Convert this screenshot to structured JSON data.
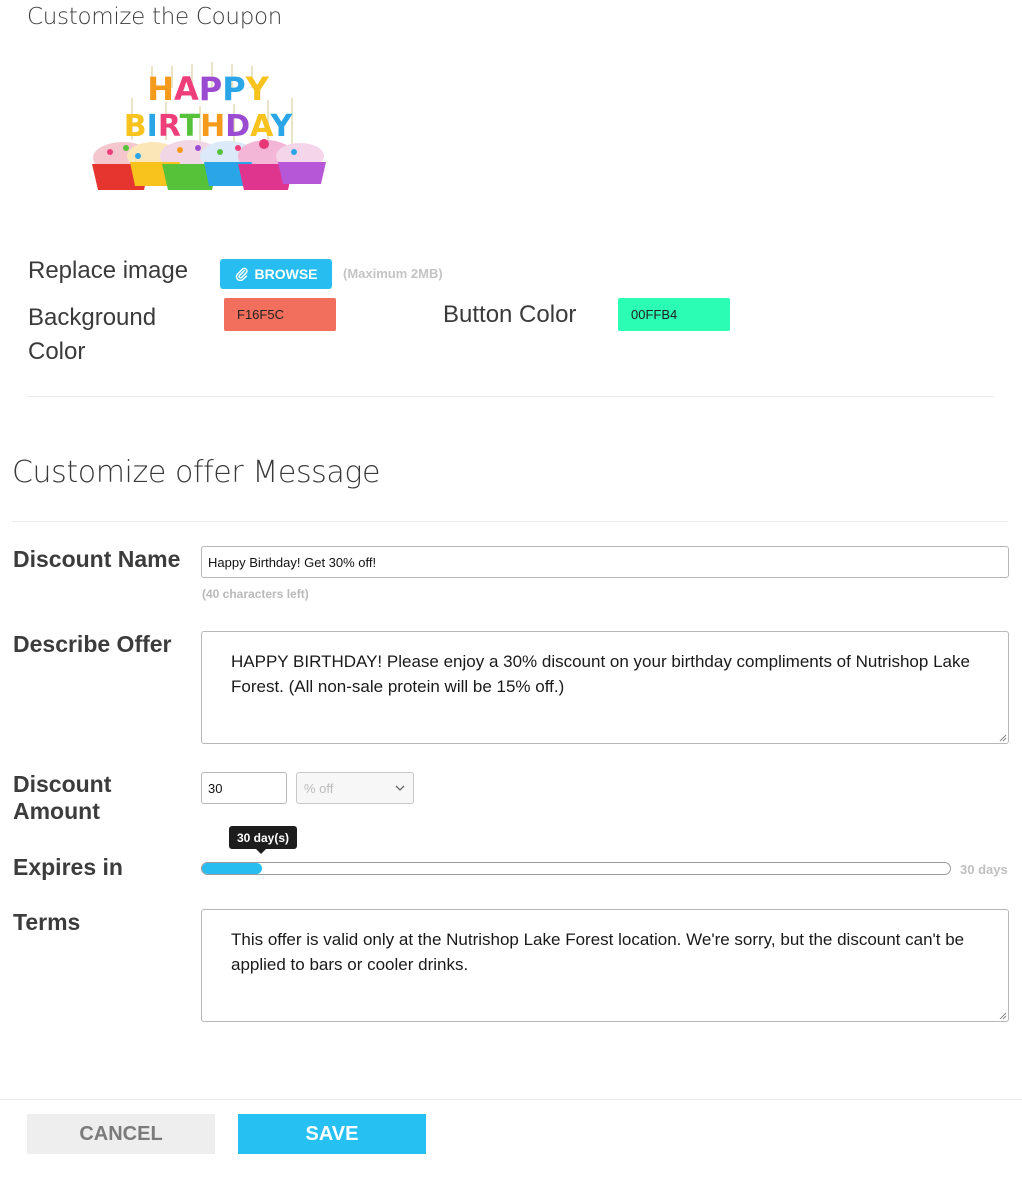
{
  "coupon": {
    "title": "Customize the Coupon",
    "image_text": "HAPPY BIRTHDAY",
    "replace_label": "Replace image",
    "browse_label": "BROWSE",
    "browse_note": "(Maximum 2MB)",
    "bg_color_label_line1": "Background",
    "bg_color_label_line2": "Color",
    "bg_color_value": "F16F5C",
    "button_color_label": "Button Color",
    "button_color_value": "00FFB4"
  },
  "colors": {
    "background": "#F16F5C",
    "button": "#2CFDB4",
    "accent": "#27BDF0"
  },
  "offer": {
    "section_title": "Customize offer Message",
    "discount_name_label": "Discount Name",
    "discount_name_value": "Happy Birthday! Get 30% off!",
    "chars_left": "(40 characters left)",
    "describe_label": "Describe Offer",
    "describe_value": "HAPPY BIRTHDAY! Please enjoy a 30% discount on your birthday compliments of Nutrishop Lake Forest. (All non-sale protein will be 15% off.)",
    "amount_label_line1": "Discount",
    "amount_label_line2": "Amount",
    "amount_value": "30",
    "amount_unit": "% off",
    "expires_label": "Expires in",
    "expires_tooltip": "30 day(s)",
    "expires_max": "30 days",
    "expires_fill_fraction": 0.08,
    "terms_label": "Terms",
    "terms_value": "This offer is valid only at the Nutrishop Lake Forest location. We're sorry, but the discount can't be applied to bars or cooler drinks."
  },
  "footer": {
    "cancel_label": "CANCEL",
    "save_label": "SAVE"
  }
}
